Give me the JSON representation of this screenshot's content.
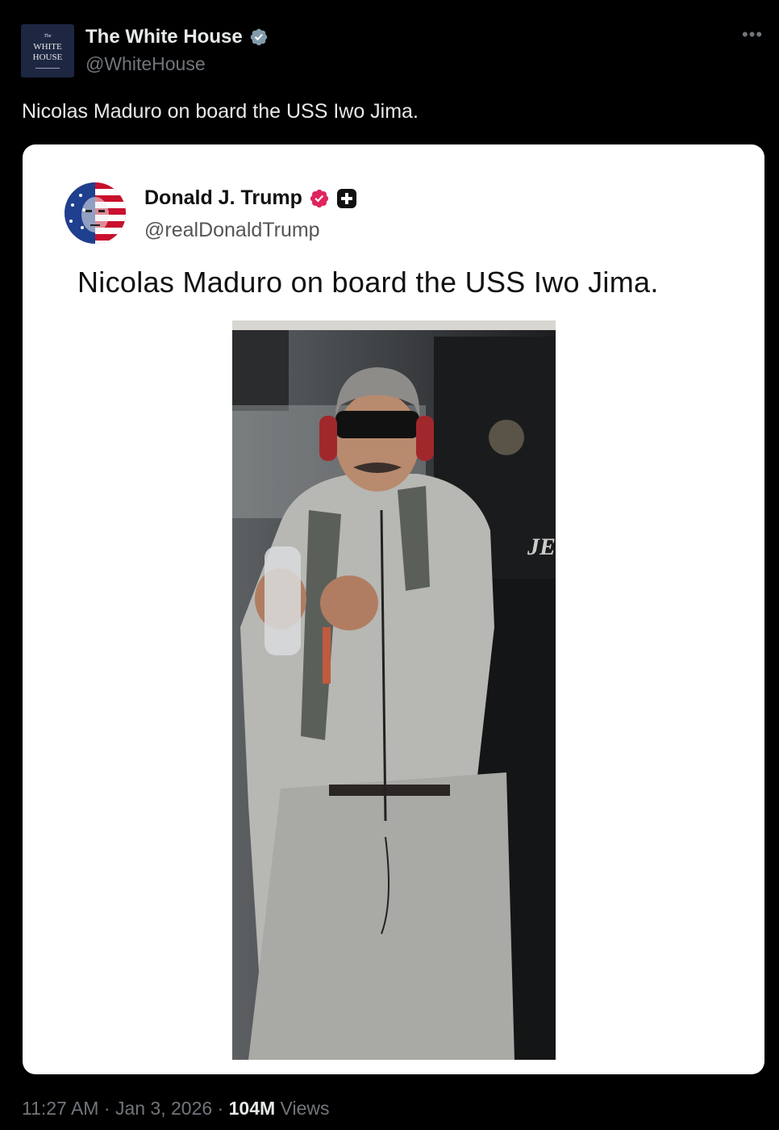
{
  "author": {
    "name": "The White House",
    "handle": "@WhiteHouse",
    "avatar_lines": [
      "The",
      "WHITE",
      "HOUSE"
    ]
  },
  "tweet_text": "Nicolas Maduro on board the USS Iwo Jima.",
  "quoted": {
    "name": "Donald J. Trump",
    "handle": "@realDonaldTrump",
    "text": "Nicolas Maduro on board the USS Iwo Jima."
  },
  "meta": {
    "time": "11:27 AM",
    "date": "Jan 3, 2026",
    "views_count": "104M",
    "views_label": "Views"
  },
  "colors": {
    "background": "#000000",
    "text": "#e7e9ea",
    "muted": "#71767b",
    "verified_gray": "#829aab",
    "verified_pink": "#e0245e"
  },
  "icons": [
    "more-icon",
    "verified-gray-icon",
    "verified-pink-icon",
    "plus-badge-icon"
  ]
}
